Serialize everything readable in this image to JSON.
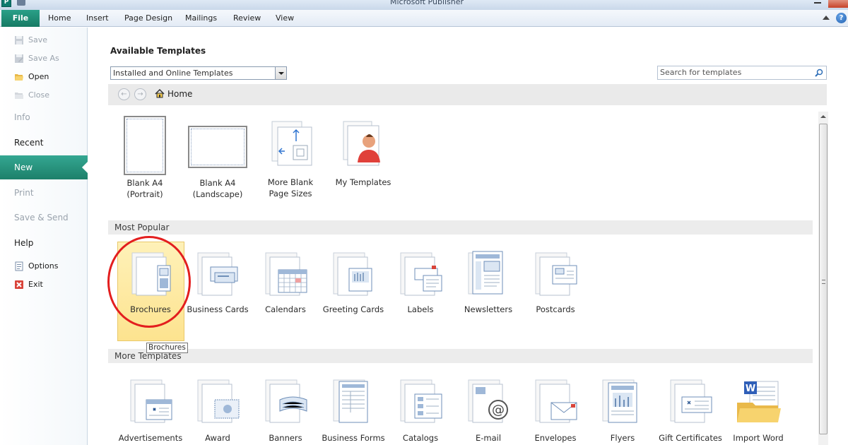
{
  "window": {
    "title": "Microsoft Publisher"
  },
  "ribbon": {
    "tabs": [
      {
        "id": "file",
        "label": "File"
      },
      {
        "id": "home",
        "label": "Home"
      },
      {
        "id": "insert",
        "label": "Insert"
      },
      {
        "id": "page_design",
        "label": "Page Design"
      },
      {
        "id": "mailings",
        "label": "Mailings"
      },
      {
        "id": "review",
        "label": "Review"
      },
      {
        "id": "view",
        "label": "View"
      }
    ],
    "help_label": "?"
  },
  "backstage": {
    "commands_top": [
      {
        "label": "Save",
        "icon": "save-icon",
        "enabled": false
      },
      {
        "label": "Save As",
        "icon": "save-as-icon",
        "enabled": false
      },
      {
        "label": "Open",
        "icon": "open-folder-icon",
        "enabled": true
      },
      {
        "label": "Close",
        "icon": "close-folder-icon",
        "enabled": false
      }
    ],
    "tabs": [
      {
        "label": "Info",
        "enabled": false
      },
      {
        "label": "Recent",
        "enabled": true
      },
      {
        "label": "New",
        "enabled": true,
        "selected": true
      },
      {
        "label": "Print",
        "enabled": false
      },
      {
        "label": "Save & Send",
        "enabled": false
      },
      {
        "label": "Help",
        "enabled": true
      }
    ],
    "commands_bottom": [
      {
        "label": "Options",
        "icon": "options-icon",
        "enabled": true
      },
      {
        "label": "Exit",
        "icon": "exit-icon",
        "enabled": true
      }
    ]
  },
  "main": {
    "heading": "Available Templates",
    "template_source": "Installed and Online Templates",
    "search_placeholder": "Search for templates",
    "breadcrumb": "Home",
    "top_tiles": [
      {
        "line1": "Blank A4",
        "line2": "(Portrait)",
        "icon": "blank-portrait-page-icon"
      },
      {
        "line1": "Blank A4",
        "line2": "(Landscape)",
        "icon": "blank-landscape-page-icon"
      },
      {
        "line1": "More Blank",
        "line2": "Page Sizes",
        "icon": "page-sizes-icon"
      },
      {
        "line1": "My Templates",
        "line2": "",
        "icon": "my-templates-icon"
      }
    ],
    "most_popular": {
      "header": "Most Popular",
      "items": [
        {
          "label": "Brochures",
          "icon": "brochure-icon",
          "selected": true
        },
        {
          "label": "Business Cards",
          "icon": "business-card-icon"
        },
        {
          "label": "Calendars",
          "icon": "calendar-icon"
        },
        {
          "label": "Greeting Cards",
          "icon": "greeting-card-icon"
        },
        {
          "label": "Labels",
          "icon": "label-icon"
        },
        {
          "label": "Newsletters",
          "icon": "newsletter-icon"
        },
        {
          "label": "Postcards",
          "icon": "postcard-icon"
        }
      ]
    },
    "tooltip": "Brochures",
    "more_templates": {
      "header": "More Templates",
      "items": [
        {
          "label": "Advertisements",
          "icon": "advertisement-icon"
        },
        {
          "label": "Award",
          "icon": "award-certificate-icon"
        },
        {
          "label": "Banners",
          "icon": "banner-icon"
        },
        {
          "label": "Business Forms",
          "icon": "business-form-icon"
        },
        {
          "label": "Catalogs",
          "icon": "catalog-icon"
        },
        {
          "label": "E-mail",
          "icon": "email-icon"
        },
        {
          "label": "Envelopes",
          "icon": "envelope-icon"
        },
        {
          "label": "Flyers",
          "icon": "flyer-icon"
        },
        {
          "label": "Gift Certificates",
          "icon": "gift-certificate-icon"
        },
        {
          "label": "Import Word",
          "icon": "import-word-icon"
        }
      ]
    }
  },
  "colors": {
    "file_tab": "#1d806a",
    "selected_tile": "#fde38f",
    "annotation_circle": "#e31e1e"
  }
}
